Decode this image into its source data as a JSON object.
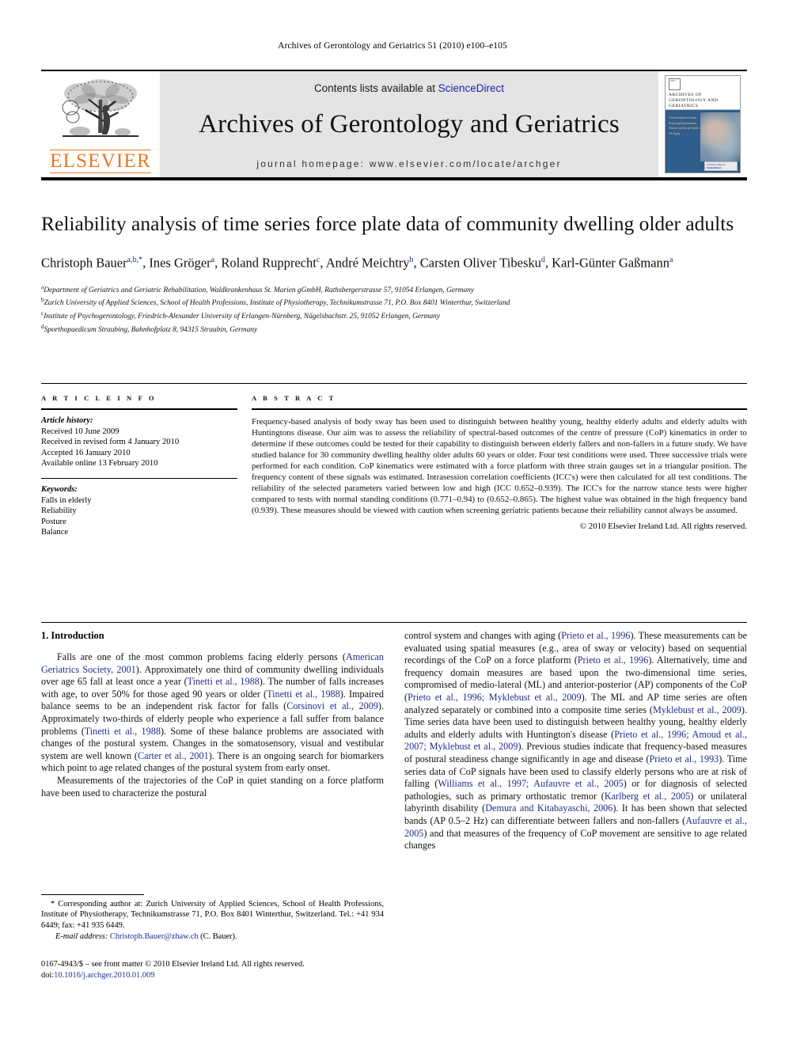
{
  "running_head": "Archives of Gerontology and Geriatrics 51 (2010) e100–e105",
  "masthead": {
    "publisher_name": "ELSEVIER",
    "contents_prefix": "Contents lists available at ",
    "contents_link": "ScienceDirect",
    "journal_title": "Archives of Gerontology and Geriatrics",
    "homepage": "journal homepage: www.elsevier.com/locate/archger",
    "cover": {
      "title": "ARCHIVES OF GERONTOLOGY AND GERIATRICS",
      "side_text": "An International Journal Reporting Experimental, Clinical and Social Studies On Aging",
      "badge_top": "available online at",
      "badge_brand": "ScienceDirect",
      "badge_url": "www.sciencedirect.com"
    }
  },
  "article": {
    "title": "Reliability analysis of time series force plate data of community dwelling older adults",
    "authors_html": "Christoph Bauer<sup>a,b,*</sup>, Ines Gröger<sup>a</sup>, Roland Rupprecht<sup>c</sup>, André Meichtry<sup>b</sup>, Carsten Oliver Tibesku<sup>d</sup>, Karl-Günter Gaßmann<sup>a</sup>",
    "affiliations": [
      {
        "marker": "a",
        "text": "Department of Geriatrics and Geriatric Rehabilitation, Waldkrankenhaus St. Marien gGmbH, Rathsbergerstrasse 57, 91054 Erlangen, Germany"
      },
      {
        "marker": "b",
        "text": "Zurich University of Applied Sciences, School of Health Professions, Institute of Physiotherapy, Technikumstrasse 71, P.O. Box 8401 Winterthur, Switzerland"
      },
      {
        "marker": "c",
        "text": "Institute of Psychogerontology, Friedrich-Alexander University of Erlangen-Nürnberg, Nägelsbachstr. 25, 91052 Erlangen, Germany"
      },
      {
        "marker": "d",
        "text": "Sporthopaedicum Straubing, Bahnhofplatz 8, 94315 Straubin, Germany"
      }
    ]
  },
  "article_info": {
    "label": "A R T I C L E    I N F O",
    "history_label": "Article history:",
    "history": [
      "Received 10 June 2009",
      "Received in revised form 4 January 2010",
      "Accepted 16 January 2010",
      "Available online 13 February 2010"
    ],
    "keywords_label": "Keywords:",
    "keywords": [
      "Falls in elderly",
      "Reliability",
      "Posture",
      "Balance"
    ]
  },
  "abstract": {
    "label": "A B S T R A C T",
    "text": "Frequency-based analysis of body sway has been used to distinguish between healthy young, healthy elderly adults and elderly adults with Huntingtons disease. Our aim was to assess the reliability of spectral-based outcomes of the centre of pressure (CoP) kinematics in order to determine if these outcomes could be tested for their capability to distinguish between elderly fallers and non-fallers in a future study. We have studied balance for 30 community dwelling healthy older adults 60 years or older. Four test conditions were used. Three successive trials were performed for each condition. CoP kinematics were estimated with a force platform with three strain gauges set in a triangular position. The frequency content of these signals was estimated. Intrasession correlation coefficients (ICC's) were then calculated for all test conditions. The reliability of the selected parameters varied between low and high (ICC 0.652–0.939). The ICC's for the narrow stance tests were higher compared to tests with normal standing conditions (0.771–0.94) to (0.652–0.865). The highest value was obtained in the high frequency band (0.939). These measures should be viewed with caution when screening geriatric patients because their reliability cannot always be assumed.",
    "copyright": "© 2010 Elsevier Ireland Ltd. All rights reserved."
  },
  "introduction": {
    "heading": "1. Introduction",
    "left_paragraphs": [
      {
        "segments": [
          {
            "t": "Falls are one of the most common problems facing elderly persons ("
          },
          {
            "t": "American Geriatrics Society, 2001",
            "ref": true
          },
          {
            "t": "). Approximately one third of community dwelling individuals over age 65 fall at least once a year ("
          },
          {
            "t": "Tinetti et al., 1988",
            "ref": true
          },
          {
            "t": "). The number of falls increases with age, to over 50% for those aged 90 years or older ("
          },
          {
            "t": "Tinetti et al., 1988",
            "ref": true
          },
          {
            "t": "). Impaired balance seems to be an independent risk factor for falls ("
          },
          {
            "t": "Corsinovi et al., 2009",
            "ref": true
          },
          {
            "t": "). Approximately two-thirds of elderly people who experience a fall suffer from balance problems ("
          },
          {
            "t": "Tinetti et al., 1988",
            "ref": true
          },
          {
            "t": "). Some of these balance problems are associated with changes of the postural system. Changes in the somatosensory, visual and vestibular system are well known ("
          },
          {
            "t": "Carter et al., 2001",
            "ref": true
          },
          {
            "t": "). There is an ongoing search for biomarkers which point to age related changes of the postural system from early onset."
          }
        ]
      },
      {
        "segments": [
          {
            "t": "Measurements of the trajectories of the CoP in quiet standing on a force platform have been used to characterize the postural"
          }
        ]
      }
    ],
    "right_paragraphs": [
      {
        "segments": [
          {
            "t": "control system and changes with aging ("
          },
          {
            "t": "Prieto et al., 1996",
            "ref": true
          },
          {
            "t": "). These measurements can be evaluated using spatial measures (e.g., area of sway or velocity) based on sequential recordings of the CoP on a force platform ("
          },
          {
            "t": "Prieto et al., 1996",
            "ref": true
          },
          {
            "t": "). Alternatively, time and frequency domain measures are based upon the two-dimensional time series, compromised of medio-lateral (ML) and anterior-posterior (AP) components of the CoP ("
          },
          {
            "t": "Prieto et al., 1996; Myklebust et al., 2009",
            "ref": true
          },
          {
            "t": "). The ML and AP time series are often analyzed separately or combined into a composite time series ("
          },
          {
            "t": "Myklebust et al., 2009",
            "ref": true
          },
          {
            "t": "). Time series data have been used to distinguish between healthy young, healthy elderly adults and elderly adults with Huntington's disease ("
          },
          {
            "t": "Prieto et al., 1996; Amoud et al., 2007; Myklebust et al., 2009",
            "ref": true
          },
          {
            "t": "). Previous studies indicate that frequency-based measures of postural steadiness change significantly in age and disease ("
          },
          {
            "t": "Prieto et al., 1993",
            "ref": true
          },
          {
            "t": "). Time series data of CoP signals have been used to classify elderly persons who are at risk of falling ("
          },
          {
            "t": "Williams et al., 1997; Aufauvre et al., 2005",
            "ref": true
          },
          {
            "t": ") or for diagnosis of selected pathologies, such as primary orthostatic tremor ("
          },
          {
            "t": "Karlberg et al., 2005",
            "ref": true
          },
          {
            "t": ") or unilateral labyrinth disability ("
          },
          {
            "t": "Demura and Kitabayaschi, 2006",
            "ref": true
          },
          {
            "t": "). It has been shown that selected bands (AP 0.5–2 Hz) can differentiate between fallers and non-fallers ("
          },
          {
            "t": "Aufauvre et al., 2005",
            "ref": true
          },
          {
            "t": ") and that measures of the frequency of CoP movement are sensitive to age related changes"
          }
        ]
      }
    ]
  },
  "footnotes": {
    "corresponding": "* Corresponding author at: Zurich University of Applied Sciences, School of Health Professions, Institute of Physiotherapy, Technikumstrasse 71, P.O. Box 8401 Winterthur, Switzerland. Tel.: +41 934 6449; fax: +41 935 6449.",
    "email_label": "E-mail address:",
    "email_address": "Christoph.Bauer@zhaw.ch",
    "email_suffix": "(C. Bauer).",
    "imprint": "0167-4943/$ – see front matter © 2010 Elsevier Ireland Ltd. All rights reserved.",
    "doi_label": "doi:",
    "doi_value": "10.1016/j.archger.2010.01.009"
  },
  "colors": {
    "elsevier_orange": "#E87722",
    "link_blue": "#1f2f8c",
    "masthead_grey": "#e4e4e4"
  }
}
